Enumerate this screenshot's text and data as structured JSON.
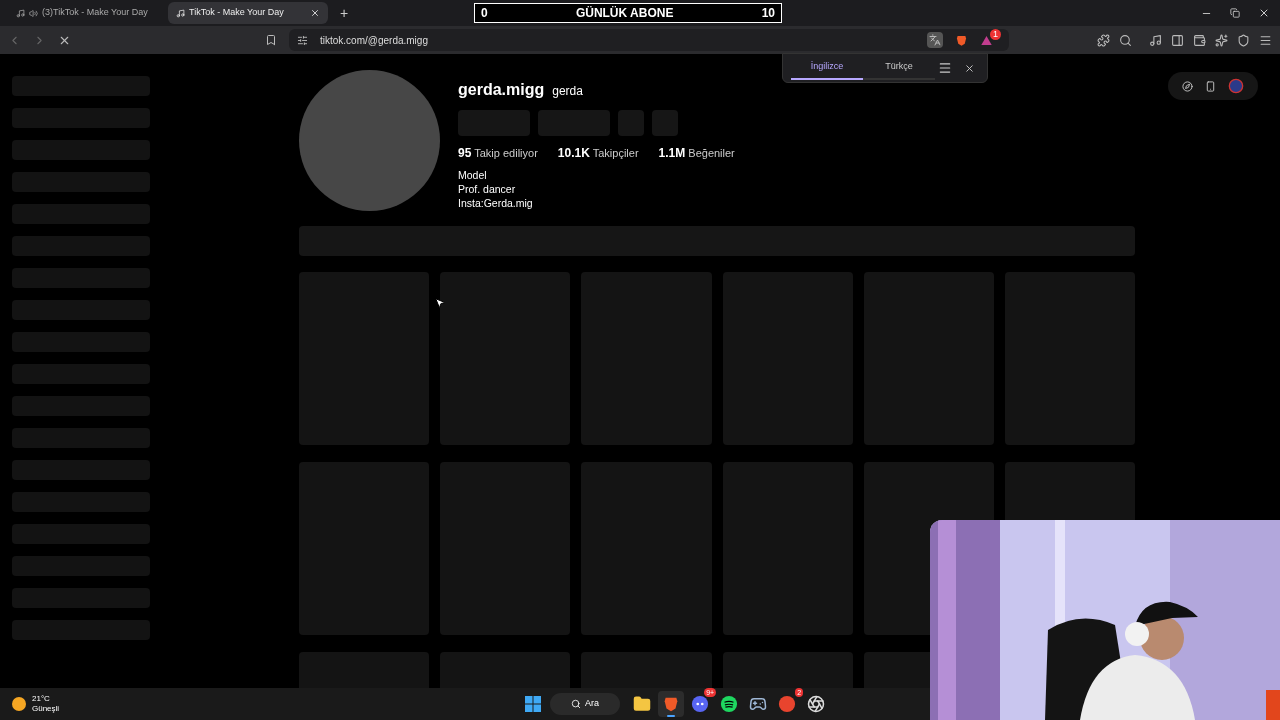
{
  "browser": {
    "tabs": [
      {
        "title": "(3)TikTok - Make Your Day",
        "selected": false,
        "audio": true
      },
      {
        "title": "TikTok - Make Your Day",
        "selected": true,
        "audio": false
      }
    ],
    "new_tab": "+",
    "address": "tiktok.com/@gerda.migg",
    "loading": true,
    "alert_badge": "1"
  },
  "counter": {
    "start": "0",
    "label": "GÜNLÜK ABONE",
    "goal": "10"
  },
  "translate_popup": {
    "languages": [
      {
        "label": "İngilizce",
        "selected": true
      },
      {
        "label": "Türkçe",
        "selected": false
      }
    ]
  },
  "profile": {
    "username": "gerda.migg",
    "nickname": "gerda",
    "stats": [
      "**95** Takip ediliyor",
      "**10.1K** Takipçiler",
      "**1.1M** Beğeniler"
    ],
    "bio": [
      "Model",
      "Prof. dancer",
      "Insta:Gerda.mig"
    ]
  },
  "taskbar": {
    "weather": {
      "temp": "21°C",
      "condition": "Güneşli"
    },
    "search": "Ara",
    "apps": [
      {
        "kind": "folder",
        "selected": false
      },
      {
        "kind": "brave",
        "selected": true
      },
      {
        "kind": "discord",
        "selected": false,
        "badge": "9+"
      },
      {
        "kind": "spotify",
        "selected": false
      },
      {
        "kind": "steam",
        "selected": false
      },
      {
        "kind": "ea",
        "selected": false,
        "badge": "2"
      },
      {
        "kind": "obs",
        "selected": false
      }
    ]
  }
}
